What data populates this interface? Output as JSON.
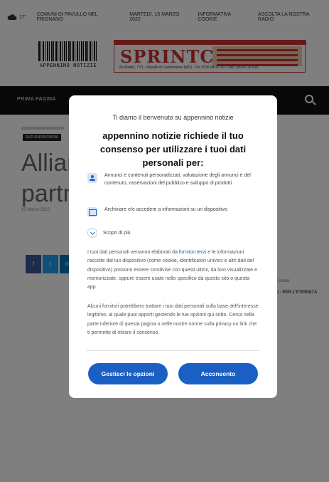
{
  "page": {
    "topbar": {
      "temperature": "17°",
      "items": [
        "COMUNI DI PAVULLO NEL FRIGNANO",
        "MARTEDÌ, 15 MARZO 2022",
        "INFORMATIVA COOKIE",
        "ASCOLTA LA NOSTRA RADIO"
      ]
    },
    "logo_text": "APPENNINO NOTIZIE",
    "ad": {
      "brand": "SPRINTCAR",
      "address": "Via Radici, 77/1 - Pavullo di Castelnuovo (MO) - Tel. 0536 94 41 30 - Cell. 339 47 25 618"
    },
    "nav": {
      "first_item": "PRIMA PAGINA"
    },
    "category": "SUD SUDDIVISIONI",
    "headline_lines": [
      "Allianz",
      "partne"
    ],
    "date": "15 Marzo 2022",
    "share_glyphs": [
      "f",
      "t",
      "in"
    ],
    "sidebar": {
      "line1": "di moda",
      "line2": "DI · PER L'ETERNITÀ"
    }
  },
  "dialog": {
    "welcome": "Ti diamo il benvenuto su appennino notizie",
    "title": "appennino notizie richiede il tuo consenso per utilizzare i tuoi dati personali per:",
    "purposes": [
      {
        "icon": "user-icon",
        "text": "Annunci e contenuti personalizzati, valutazione degli annunci e del contenuto, osservazioni del pubblico e sviluppo di prodotti"
      },
      {
        "icon": "device-icon",
        "text": "Archiviare e/o accedere a informazioni su un dispositivo"
      }
    ],
    "more_label": "Scopri di più",
    "para1_before": "I tuoi dati personali verranno elaborati da ",
    "para1_link": "fornitori terzi",
    "para1_after": " e le informazioni raccolte dal tuo dispositivo (come cookie, identificatori univoci e altri dati del dispositivo) possono essere condivise con questi ultimi, da loro visualizzate e memorizzate, oppure essere usate nello specifico da questo sito o questa app.",
    "para2": "Alcuni fornitori potrebbero trattare i tuoi dati personali sulla base dell'interesse legittimo, al quale puoi opporti gestendo le tue opzioni qui sotto. Cerca nella parte inferiore di questa pagina o nelle nostre norme sulla privacy un link che ti permette di ritirare il consenso.",
    "manage_button": "Gestisci le opzioni",
    "accept_button": "Acconsento"
  },
  "colors": {
    "accent": "#1a60c4",
    "overlay": "rgba(0,0,0,0.5)",
    "navbar": "#111111",
    "ad_brand": "#cc3333"
  }
}
